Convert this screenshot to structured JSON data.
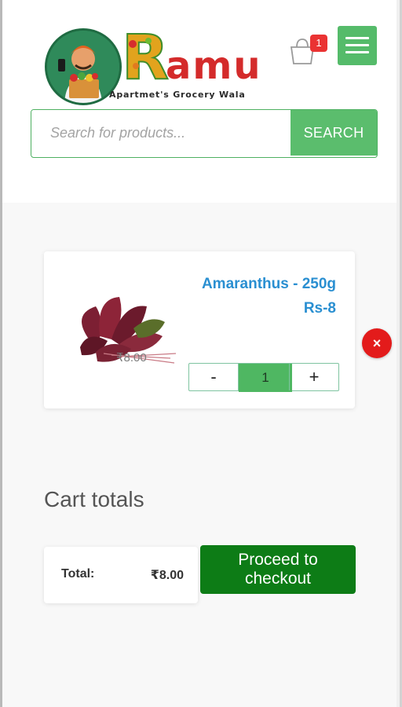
{
  "header": {
    "logo": {
      "wordmark": "Ramu",
      "tagline": "Apartmet's Grocery Wala"
    },
    "cart_count": "1",
    "search": {
      "placeholder": "Search for products...",
      "button_label": "SEARCH"
    }
  },
  "cart": {
    "items": [
      {
        "name": "Amaranthus - 250g Rs-8",
        "price": "₹8.00",
        "quantity": "1",
        "minus_label": "-",
        "plus_label": "+",
        "remove_label": "×"
      }
    ]
  },
  "totals": {
    "title": "Cart totals",
    "total_label": "Total:",
    "total_value": "₹8.00",
    "checkout_label": "Proceed to checkout"
  },
  "colors": {
    "brand_green": "#5bbd6d",
    "checkout_green": "#0d7c16",
    "link_blue": "#2a8fd1",
    "remove_red": "#e31b1b"
  }
}
